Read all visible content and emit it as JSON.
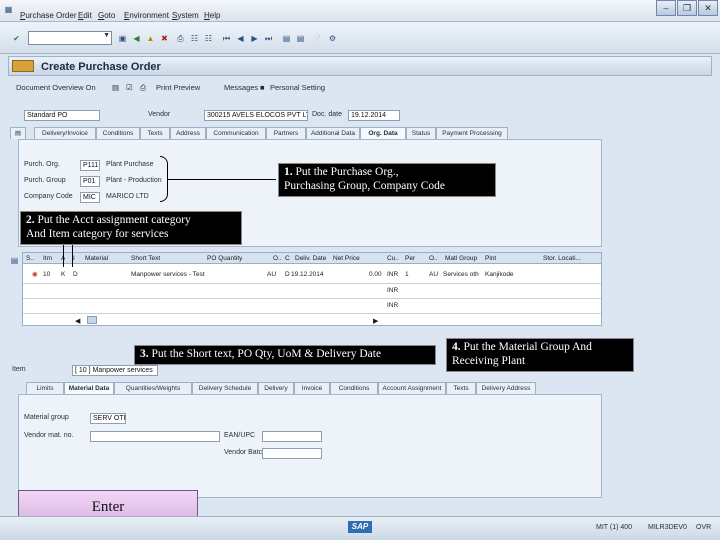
{
  "menu": {
    "items": [
      "Purchase Order",
      "Edit",
      "Goto",
      "Environment",
      "System",
      "Help"
    ]
  },
  "title": "Create Purchase Order",
  "app_toolbar": {
    "doc_overview": "Document Overview On",
    "print_preview": "Print Preview",
    "messages": "Messages",
    "personal_setting": "Personal Setting"
  },
  "header": {
    "doc_type": "Standard PO",
    "vendor_label": "Vendor",
    "vendor_value": "300215 AVELS ELOCOS PVT LTD",
    "doc_date_label": "Doc. date",
    "doc_date_value": "19.12.2014"
  },
  "header_tabs": [
    "Delivery/Invoice",
    "Conditions",
    "Texts",
    "Address",
    "Communication",
    "Partners",
    "Additional Data",
    "Org. Data",
    "Status",
    "Payment Processing"
  ],
  "org_data": {
    "rows": [
      {
        "label": "Purch. Org.",
        "code": "P111",
        "desc": "Plant Purchase"
      },
      {
        "label": "Purch. Group",
        "code": "P01",
        "desc": "Plant - Production"
      },
      {
        "label": "Company Code",
        "code": "MIC",
        "desc": "MARICO LTD"
      }
    ]
  },
  "items_table": {
    "headers": [
      "S..",
      "Itm",
      "A",
      "I",
      "Material",
      "Short Text",
      "PO Quantity",
      "O..",
      "C",
      "Deliv. Date",
      "Net Price",
      "Cu..",
      "Per",
      "O..",
      "Matl Group",
      "Plnt",
      "Stor. Locati..."
    ],
    "row": {
      "itm": "10",
      "a": "K",
      "i": "D",
      "short_text": "Manpower services - Test",
      "o": "AU",
      "c": "D",
      "deliv_date": "19.12.2014",
      "net_price": "0.00",
      "cu": "INR",
      "per": "1",
      "o2": "AU",
      "matl_group": "Services oth",
      "plnt": "Kanjikode"
    },
    "extra_cu": [
      "INR",
      "INR"
    ]
  },
  "item_detail": {
    "label": "Item",
    "value": "[ 10 ] Manpower services",
    "tabs": [
      "Limits",
      "Material Data",
      "Quantities/Weights",
      "Delivery Schedule",
      "Delivery",
      "Invoice",
      "Conditions",
      "Account Assignment",
      "Texts",
      "Delivery Address"
    ],
    "material_group_label": "Material group",
    "material_group_value": "SERV OTH",
    "vendor_mat_label": "Vendor mat. no.",
    "ean_label": "EAN/UPC",
    "vendor_batch_label": "Vendor Batch"
  },
  "callouts": {
    "c1_num": "1.",
    "c1_text": "Put the Purchase Org.,\n   Purchasing Group, Company Code",
    "c2_num": "2.",
    "c2_text": "Put the Acct assignment category\n   And Item category for services",
    "c3_num": "3.",
    "c3_text": "Put the Short text, PO Qty, UoM & Delivery Date",
    "c4_num": "4.",
    "c4_text": "Put the Material Group And\nReceiving Plant"
  },
  "enter_label": "Enter",
  "status": {
    "sap": "SAP",
    "system": "MIT (1) 400",
    "server": "MILR3DEV0",
    "mode": "OVR"
  },
  "colors": {
    "background": "#dbe6f2",
    "callout": "#000000",
    "enter_button": "#e8c8ee"
  }
}
